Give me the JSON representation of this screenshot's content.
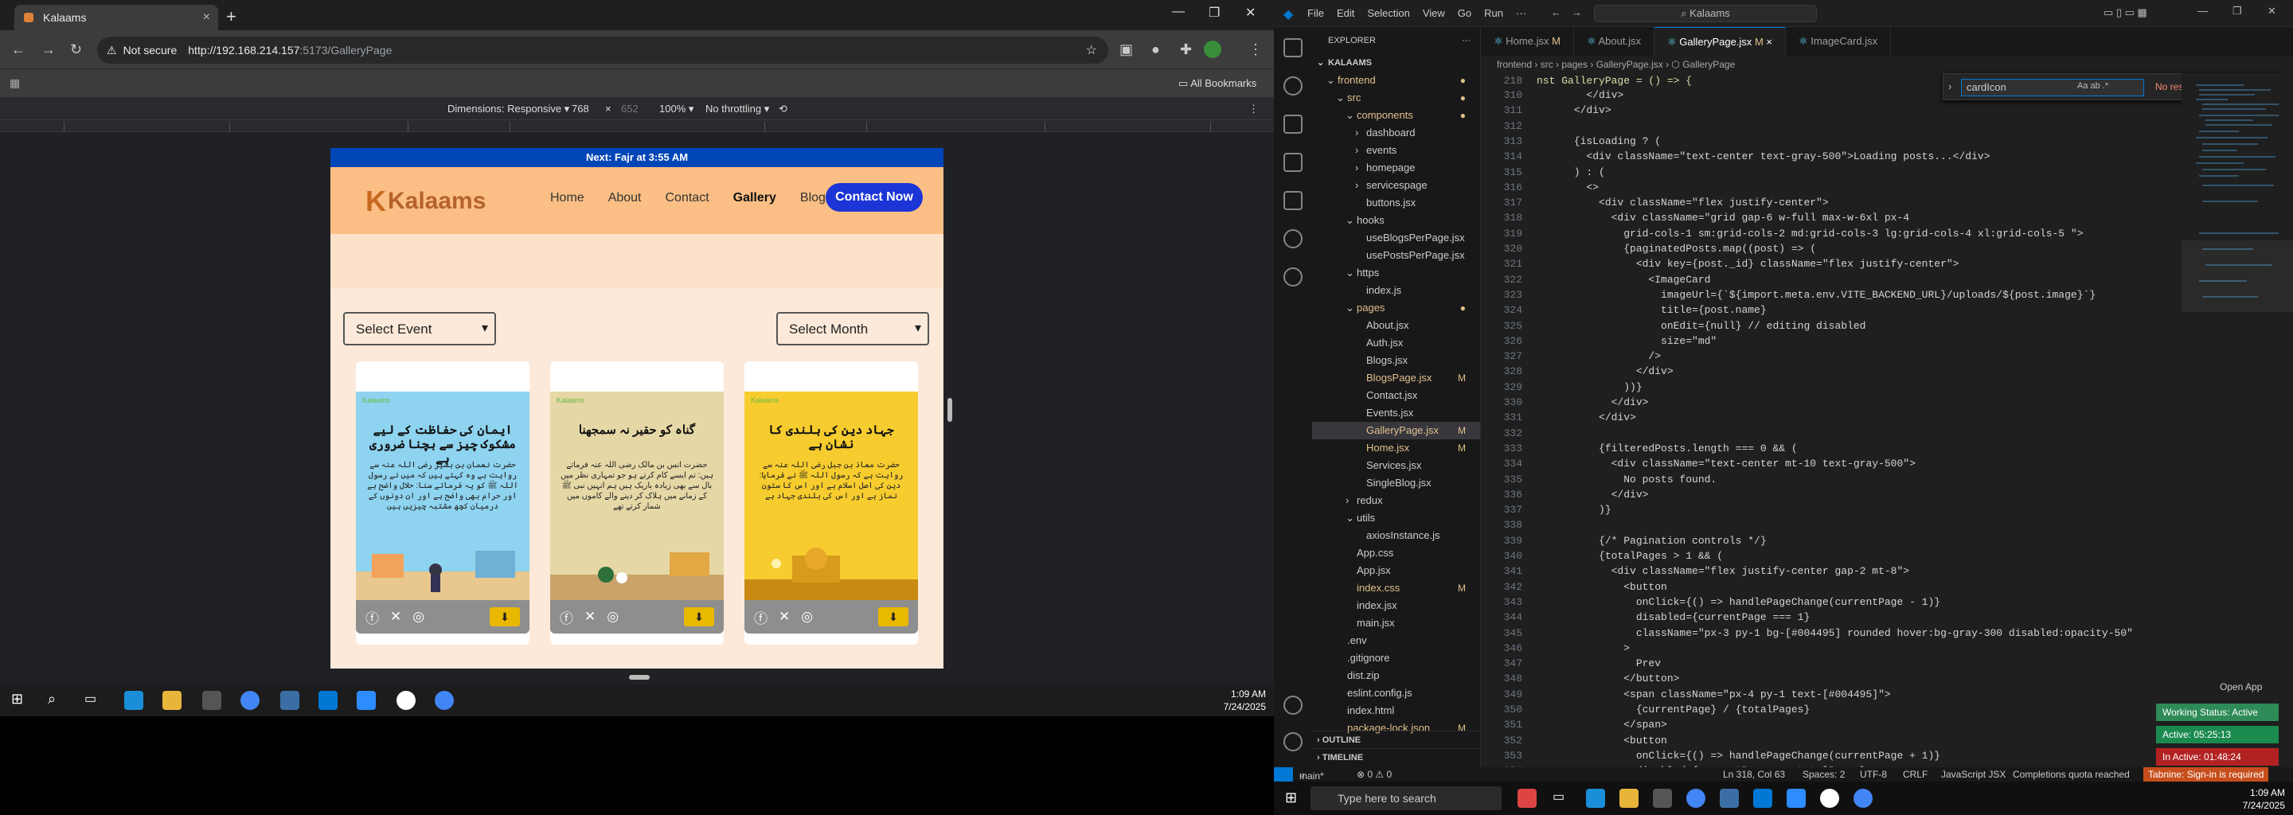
{
  "browser": {
    "tab_title": "Kalaams",
    "not_secure": "Not secure",
    "url_host": "http://192.168.214.157",
    "url_rest": ":5173/GalleryPage",
    "all_bookmarks": "All Bookmarks",
    "devtools": {
      "dimensions": "Dimensions: Responsive ▾",
      "width": "768",
      "x": "×",
      "height": "652",
      "zoom": "100% ▾",
      "throttle": "No throttling ▾"
    }
  },
  "site": {
    "topbar": "Next: Fajr at 3:55 AM",
    "logo": "Kalaams",
    "nav": [
      "Home",
      "About",
      "Contact",
      "Gallery",
      "Blogs"
    ],
    "contact_button": "Contact Now",
    "select_event": "Select Event",
    "select_month": "Select Month",
    "cards": [
      {
        "title": "ایمان کی حفاظت کے لیے مشکوک چیز سے بچنا ضروری ہے",
        "body": "حضرت نعمان بن بشیر رضی اللہ عنہ سے روایت ہے وہ کہتے ہیں کہ میں نے رسول اللہ ﷺ کو یہ فرماتے سنا: حلال واضح ہے اور حرام بھی واضح ہے اور ان دونوں کے درمیان کچھ مشتبہ چیزیں ہیں",
        "bg": "#8ed3ef",
        "brand": "Kalaams"
      },
      {
        "title": "گناہ کو حقیر نہ سمجھنا",
        "body": "حضرت انس بن مالک رضی اللہ عنہ فرماتے ہیں: تم ایسے کام کرتے ہو جو تمہاری نظر میں بال سے بھی زیادہ باریک ہیں ہم انہیں نبی ﷺ کے زمانے میں ہلاک کر دینے والے کاموں میں شمار کرتے تھے",
        "bg": "#e6d7a6",
        "brand": "Kalaams"
      },
      {
        "title": "جہاد دین کی بلندی کا نشان ہے",
        "body": "حضرت معاذ بن جبل رضی اللہ عنہ سے روایت ہے کہ رسول اللہ ﷺ نے فرمایا: دین کی اصل اسلام ہے اور اس کا ستون نماز ہے اور اس کی بلندی جہاد ہے",
        "bg": "#f7cc2e",
        "brand": "Kalaams"
      }
    ]
  },
  "taskbar_left": {
    "time": "1:09 AM",
    "date": "7/24/2025"
  },
  "vscode": {
    "menu": [
      "File",
      "Edit",
      "Selection",
      "View",
      "Go",
      "Run",
      "···"
    ],
    "search": "Kalaams",
    "tabs": [
      {
        "label": "Home.jsx",
        "mod": "M"
      },
      {
        "label": "About.jsx",
        "mod": ""
      },
      {
        "label": "GalleryPage.jsx",
        "mod": "M"
      },
      {
        "label": "ImageCard.jsx",
        "mod": ""
      }
    ],
    "breadcrumb": "frontend › src › pages › GalleryPage.jsx › ⬡ GalleryPage",
    "find_value": "cardIcon",
    "find_result": "No results",
    "explorer_title": "EXPLORER",
    "tree": [
      {
        "label": "KALAAMS",
        "indent": 0,
        "arrow": "⌄",
        "mod": ""
      },
      {
        "label": "frontend",
        "indent": 1,
        "arrow": "⌄",
        "mod": "●",
        "git": true
      },
      {
        "label": "src",
        "indent": 2,
        "arrow": "⌄",
        "mod": "●",
        "git": true
      },
      {
        "label": "components",
        "indent": 3,
        "arrow": "⌄",
        "mod": "●",
        "git": true
      },
      {
        "label": "dashboard",
        "indent": 4,
        "arrow": "›",
        "mod": ""
      },
      {
        "label": "events",
        "indent": 4,
        "arrow": "›",
        "mod": ""
      },
      {
        "label": "homepage",
        "indent": 4,
        "arrow": "›",
        "mod": ""
      },
      {
        "label": "servicespage",
        "indent": 4,
        "arrow": "›",
        "mod": ""
      },
      {
        "label": "buttons.jsx",
        "indent": 4,
        "arrow": "",
        "mod": ""
      },
      {
        "label": "hooks",
        "indent": 3,
        "arrow": "⌄",
        "mod": ""
      },
      {
        "label": "useBlogsPerPage.jsx",
        "indent": 4,
        "arrow": "",
        "mod": ""
      },
      {
        "label": "usePostsPerPage.jsx",
        "indent": 4,
        "arrow": "",
        "mod": ""
      },
      {
        "label": "https",
        "indent": 3,
        "arrow": "⌄",
        "mod": ""
      },
      {
        "label": "index.js",
        "indent": 4,
        "arrow": "",
        "mod": ""
      },
      {
        "label": "pages",
        "indent": 3,
        "arrow": "⌄",
        "mod": "●",
        "git": true
      },
      {
        "label": "About.jsx",
        "indent": 4,
        "arrow": "",
        "mod": ""
      },
      {
        "label": "Auth.jsx",
        "indent": 4,
        "arrow": "",
        "mod": ""
      },
      {
        "label": "Blogs.jsx",
        "indent": 4,
        "arrow": "",
        "mod": ""
      },
      {
        "label": "BlogsPage.jsx",
        "indent": 4,
        "arrow": "",
        "mod": "M",
        "git": true
      },
      {
        "label": "Contact.jsx",
        "indent": 4,
        "arrow": "",
        "mod": ""
      },
      {
        "label": "Events.jsx",
        "indent": 4,
        "arrow": "",
        "mod": ""
      },
      {
        "label": "GalleryPage.jsx",
        "indent": 4,
        "arrow": "",
        "mod": "M",
        "git": true,
        "selected": true
      },
      {
        "label": "Home.jsx",
        "indent": 4,
        "arrow": "",
        "mod": "M",
        "git": true
      },
      {
        "label": "Services.jsx",
        "indent": 4,
        "arrow": "",
        "mod": ""
      },
      {
        "label": "SingleBlog.jsx",
        "indent": 4,
        "arrow": "",
        "mod": ""
      },
      {
        "label": "redux",
        "indent": 3,
        "arrow": "›",
        "mod": ""
      },
      {
        "label": "utils",
        "indent": 3,
        "arrow": "⌄",
        "mod": ""
      },
      {
        "label": "axiosInstance.js",
        "indent": 4,
        "arrow": "",
        "mod": ""
      },
      {
        "label": "App.css",
        "indent": 3,
        "arrow": "",
        "mod": ""
      },
      {
        "label": "App.jsx",
        "indent": 3,
        "arrow": "",
        "mod": ""
      },
      {
        "label": "index.css",
        "indent": 3,
        "arrow": "",
        "mod": "M",
        "git": true
      },
      {
        "label": "index.jsx",
        "indent": 3,
        "arrow": "",
        "mod": ""
      },
      {
        "label": "main.jsx",
        "indent": 3,
        "arrow": "",
        "mod": ""
      },
      {
        "label": ".env",
        "indent": 2,
        "arrow": "",
        "mod": ""
      },
      {
        "label": ".gitignore",
        "indent": 2,
        "arrow": "",
        "mod": ""
      },
      {
        "label": "dist.zip",
        "indent": 2,
        "arrow": "",
        "mod": ""
      },
      {
        "label": "eslint.config.js",
        "indent": 2,
        "arrow": "",
        "mod": ""
      },
      {
        "label": "index.html",
        "indent": 2,
        "arrow": "",
        "mod": ""
      },
      {
        "label": "package-lock.json",
        "indent": 2,
        "arrow": "",
        "mod": "M",
        "git": true
      }
    ],
    "outline": "OUTLINE",
    "timeline": "TIMELINE",
    "code_lines": [
      {
        "n": "310",
        "t": "        </div>"
      },
      {
        "n": "311",
        "t": "      </div>"
      },
      {
        "n": "312",
        "t": ""
      },
      {
        "n": "313",
        "t": "      {isLoading ? ("
      },
      {
        "n": "314",
        "t": "        <div className=\"text-center text-gray-500\">Loading posts...</div>"
      },
      {
        "n": "315",
        "t": "      ) : ("
      },
      {
        "n": "316",
        "t": "        <>"
      },
      {
        "n": "317",
        "t": "          <div className=\"flex justify-center\">"
      },
      {
        "n": "318",
        "t": "            <div className=\"grid gap-6 w-full max-w-6xl px-4"
      },
      {
        "n": "319",
        "t": "              grid-cols-1 sm:grid-cols-2 md:grid-cols-3 lg:grid-cols-4 xl:grid-cols-5 \">"
      },
      {
        "n": "320",
        "t": "              {paginatedPosts.map((post) => ("
      },
      {
        "n": "321",
        "t": "                <div key={post._id} className=\"flex justify-center\">"
      },
      {
        "n": "322",
        "t": "                  <ImageCard"
      },
      {
        "n": "323",
        "t": "                    imageUrl={`${import.meta.env.VITE_BACKEND_URL}/uploads/${post.image}`}"
      },
      {
        "n": "324",
        "t": "                    title={post.name}"
      },
      {
        "n": "325",
        "t": "                    onEdit={null} // editing disabled"
      },
      {
        "n": "326",
        "t": "                    size=\"md\""
      },
      {
        "n": "327",
        "t": "                  />"
      },
      {
        "n": "328",
        "t": "                </div>"
      },
      {
        "n": "329",
        "t": "              ))}"
      },
      {
        "n": "330",
        "t": "            </div>"
      },
      {
        "n": "331",
        "t": "          </div>"
      },
      {
        "n": "332",
        "t": ""
      },
      {
        "n": "333",
        "t": "          {filteredPosts.length === 0 && ("
      },
      {
        "n": "334",
        "t": "            <div className=\"text-center mt-10 text-gray-500\">"
      },
      {
        "n": "335",
        "t": "              No posts found."
      },
      {
        "n": "336",
        "t": "            </div>"
      },
      {
        "n": "337",
        "t": "          )}"
      },
      {
        "n": "338",
        "t": ""
      },
      {
        "n": "339",
        "t": "          {/* Pagination controls */}"
      },
      {
        "n": "340",
        "t": "          {totalPages > 1 && ("
      },
      {
        "n": "341",
        "t": "            <div className=\"flex justify-center gap-2 mt-8\">"
      },
      {
        "n": "342",
        "t": "              <button"
      },
      {
        "n": "343",
        "t": "                onClick={() => handlePageChange(currentPage - 1)}"
      },
      {
        "n": "344",
        "t": "                disabled={currentPage === 1}"
      },
      {
        "n": "345",
        "t": "                className=\"px-3 py-1 bg-[#004495] rounded hover:bg-gray-300 disabled:opacity-50\""
      },
      {
        "n": "346",
        "t": "              >"
      },
      {
        "n": "347",
        "t": "                Prev"
      },
      {
        "n": "348",
        "t": "              </button>"
      },
      {
        "n": "349",
        "t": "              <span className=\"px-4 py-1 text-[#004495]\">"
      },
      {
        "n": "350",
        "t": "                {currentPage} / {totalPages}"
      },
      {
        "n": "351",
        "t": "              </span>"
      },
      {
        "n": "352",
        "t": "              <button"
      },
      {
        "n": "353",
        "t": "                onClick={() => handlePageChange(currentPage + 1)}"
      },
      {
        "n": "354",
        "t": "                disabled={currentPage === totalPages}"
      }
    ],
    "sticky": {
      "n": "218",
      "t": "nst GalleryPage = () => {"
    },
    "status": {
      "branch": "main*",
      "errors": "⊗ 0 ⚠ 0",
      "position": "Ln 318, Col 63",
      "spaces": "Spaces: 2",
      "encoding": "UTF-8",
      "eol": "CRLF",
      "lang": "JavaScript JSX",
      "quota": "Completions quota reached",
      "tabnine": "Tabnine: Sign-in is required"
    },
    "open_app": "Open App",
    "working_status": "Working Status: Active",
    "active_time": "Active: 05:25:13",
    "inactive_time": "In Active: 01:48:24"
  },
  "taskbar_right": {
    "search_placeholder": "Type here to search",
    "time": "1:09 AM",
    "date": "7/24/2025"
  },
  "colors": {
    "topbar": "#0046b7",
    "header": "#fbbf85",
    "accent": "#1c35d6",
    "vscode_blue": "#0078d4"
  }
}
